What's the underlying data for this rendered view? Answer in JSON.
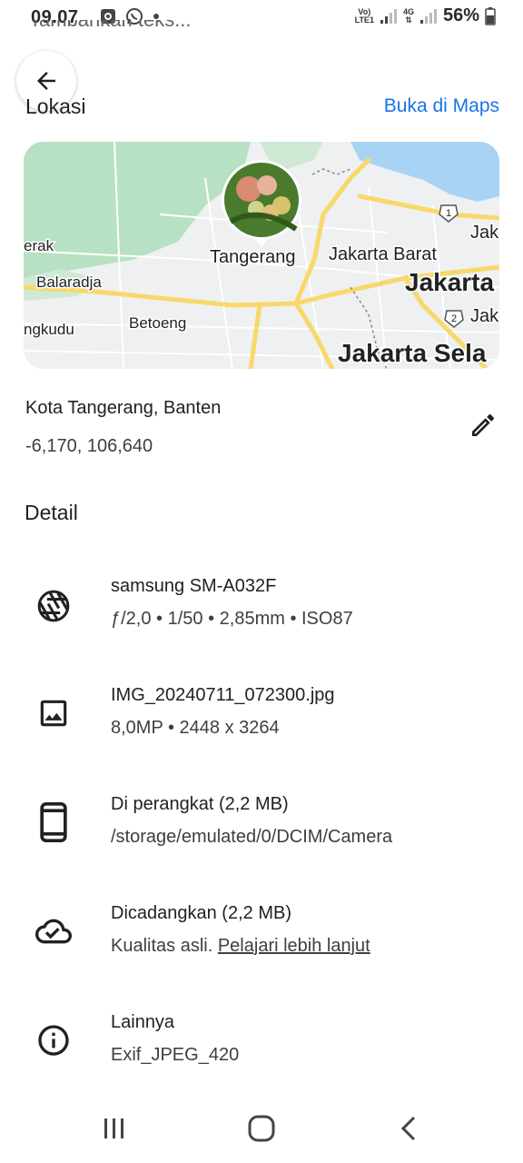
{
  "status_bar": {
    "time": "09.07",
    "net_line1": "Vo)",
    "net_line2": "LTE1",
    "net_4g": "4G",
    "battery": "56%"
  },
  "header": {
    "previous_text_cut": "Tambahkan teks...",
    "location_title": "Lokasi",
    "open_maps_label": "Buka di Maps"
  },
  "map": {
    "labels": {
      "tangerang": "Tangerang",
      "jakarta_barat": "Jakarta Barat",
      "jakarta": "Jakarta",
      "jakarta_selatan": "Jakarta Sela",
      "jak1": "Jak",
      "jak2": "Jak",
      "erak": "erak",
      "balaradja": "Balaradja",
      "betoeng": "Betoeng",
      "ngkudu": "ngkudu",
      "shield1": "1",
      "shield2": "2"
    },
    "colors": {
      "land": "#eef0f1",
      "green": "#b7e1c2",
      "water": "#a8d3f5",
      "major_road": "#f9d86b",
      "minor_road": "#ffffff"
    }
  },
  "location": {
    "name": "Kota Tangerang, Banten",
    "coords": "-6,170, 106,640"
  },
  "detail": {
    "title": "Detail",
    "rows": [
      {
        "icon": "camera-shutter-icon",
        "title": "samsung SM-A032F",
        "sub": "ƒ/2,0  •  1/50  •  2,85mm  •  ISO87"
      },
      {
        "icon": "image-icon",
        "title": "IMG_20240711_072300.jpg",
        "sub": "8,0MP  •  2448 x 3264"
      },
      {
        "icon": "phone-device-icon",
        "title": "Di perangkat (2,2 MB)",
        "sub": "/storage/emulated/0/DCIM/Camera"
      },
      {
        "icon": "cloud-done-icon",
        "title": "Dicadangkan (2,2 MB)",
        "sub_prefix": "Kualitas asli.",
        "sub_link": "Pelajari lebih lanjut"
      },
      {
        "icon": "info-icon",
        "title": "Lainnya",
        "sub": "Exif_JPEG_420"
      }
    ]
  }
}
